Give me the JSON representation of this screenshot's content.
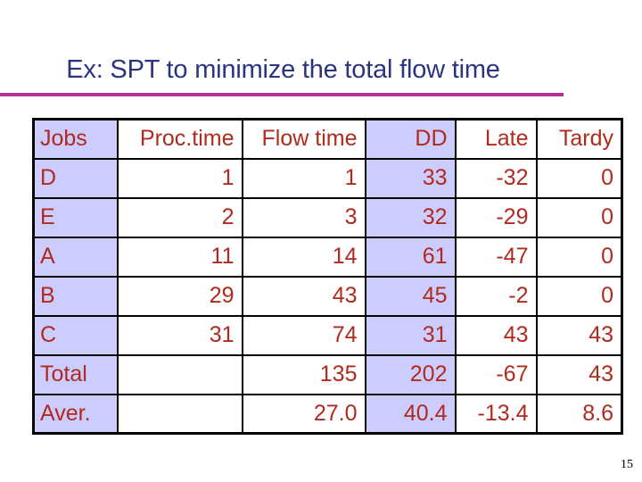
{
  "slide": {
    "title": "Ex: SPT to minimize the total flow time",
    "page_number": "15",
    "colors": {
      "title": "#2b3480",
      "rule": "#b0318f",
      "table_text": "#b02a1e",
      "shaded_column": "#ccccff"
    }
  },
  "table": {
    "headers": [
      "Jobs",
      "Proc.time",
      "Flow time",
      "DD",
      "Late",
      "Tardy"
    ],
    "rows": [
      [
        "D",
        "1",
        "1",
        "33",
        "-32",
        "0"
      ],
      [
        "E",
        "2",
        "3",
        "32",
        "-29",
        "0"
      ],
      [
        "A",
        "11",
        "14",
        "61",
        "-47",
        "0"
      ],
      [
        "B",
        "29",
        "43",
        "45",
        "-2",
        "0"
      ],
      [
        "C",
        "31",
        "74",
        "31",
        "43",
        "43"
      ],
      [
        "Total",
        "",
        "135",
        "202",
        "-67",
        "43"
      ],
      [
        "Aver.",
        "",
        "27.0",
        "40.4",
        "-13.4",
        "8.6"
      ]
    ]
  }
}
